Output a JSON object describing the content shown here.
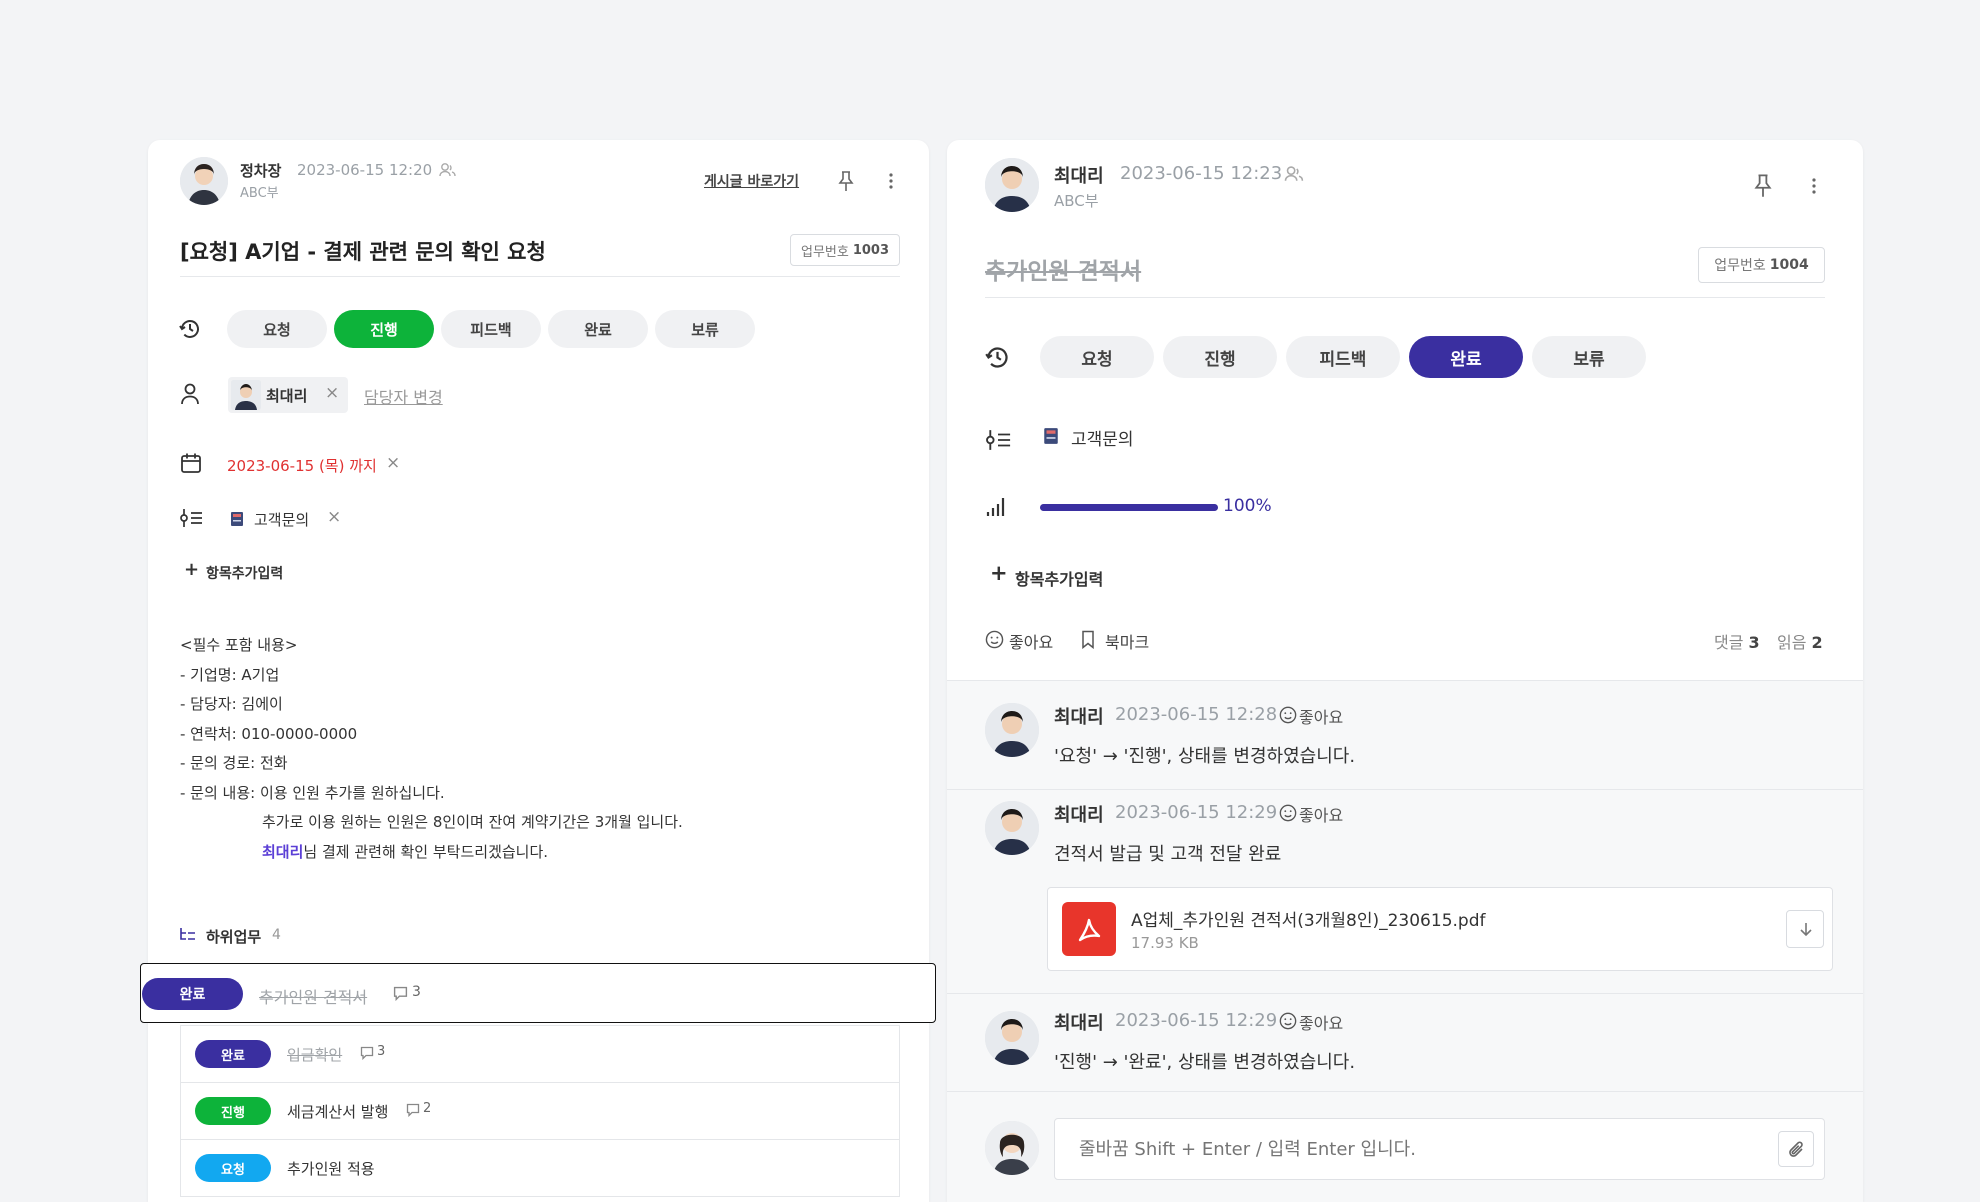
{
  "colors": {
    "green": "#0db33a",
    "purple": "#3a2fa0",
    "blue": "#12a8f0",
    "red": "#e03131",
    "mention": "#5b3fd6"
  },
  "left": {
    "author": {
      "name": "정차장",
      "date": "2023-06-15 12:20",
      "dept": "ABC부"
    },
    "goto_post": "게시글 바로가기",
    "title": "[요청] A기업 - 결제 관련 문의 확인 요청",
    "task_no_label": "업무번호",
    "task_no": "1003",
    "statuses": [
      "요청",
      "진행",
      "피드백",
      "완료",
      "보류"
    ],
    "assignee": "최대리",
    "assignee_change": "담당자 변경",
    "due": "2023-06-15 (목) 까지",
    "category": "고객문의",
    "add_item": "항목추가입력",
    "body": [
      "<필수 포함 내용>",
      "- 기업명: A기업",
      "- 담당자: 김에이",
      "- 연락처: 010-0000-0000",
      "- 문의 경로: 전화",
      "- 문의 내용: 이용 인원 추가를 원하십니다."
    ],
    "body_indent1": "추가로 이용 원하는 인원은 8인이며 잔여 계약기간은 3개월 입니다.",
    "body_mention": "최대리",
    "body_indent2_rest": "님 결제 관련해 확인 부탁드리겠습니다.",
    "subtasks_label": "하위업무",
    "subtasks_count": "4",
    "subtasks": [
      {
        "status": "완료",
        "title": "추가인원 견적서",
        "comments": "3"
      },
      {
        "status": "완료",
        "title": "입금확인",
        "comments": "3"
      },
      {
        "status": "진행",
        "title": "세금계산서 발행",
        "comments": "2"
      },
      {
        "status": "요청",
        "title": "추가인원 적용",
        "comments": ""
      }
    ],
    "close_glyph": "×"
  },
  "right": {
    "author": {
      "name": "최대리",
      "date": "2023-06-15 12:23",
      "dept": "ABC부"
    },
    "title": "추가인원 견적서",
    "task_no_label": "업무번호",
    "task_no": "1004",
    "statuses": [
      "요청",
      "진행",
      "피드백",
      "완료",
      "보류"
    ],
    "category": "고객문의",
    "progress": 100,
    "progress_label": "100%",
    "add_item": "항목추가입력",
    "like": "좋아요",
    "bookmark": "북마크",
    "comments_label": "댓글",
    "comments_count": "3",
    "reads_label": "읽음",
    "reads_count": "2",
    "comments": [
      {
        "name": "최대리",
        "date": "2023-06-15 12:28",
        "like": "좋아요",
        "text": "'요청' → '진행', 상태를 변경하였습니다."
      },
      {
        "name": "최대리",
        "date": "2023-06-15 12:29",
        "like": "좋아요",
        "text": "견적서 발급 및 고객 전달 완료"
      },
      {
        "name": "최대리",
        "date": "2023-06-15 12:29",
        "like": "좋아요",
        "text": "'진행' → '완료', 상태를 변경하였습니다."
      }
    ],
    "attachment": {
      "name": "A업체_추가인원 견적서(3개월8인)_230615.pdf",
      "size": "17.93 KB"
    },
    "input_placeholder": "줄바꿈 Shift + Enter / 입력 Enter 입니다."
  }
}
